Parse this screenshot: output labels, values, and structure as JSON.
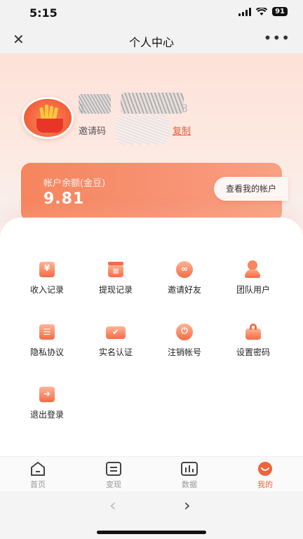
{
  "status_bar": {
    "time": "5:15",
    "battery": "91"
  },
  "nav": {
    "close_icon": "close-icon",
    "title": "个人中心",
    "more_icon": "more-icon"
  },
  "profile": {
    "user_id_prefix": "1",
    "user_id_suffix": "3",
    "invite_label": "邀请码",
    "copy_label": "复制"
  },
  "balance": {
    "label": "帐户余额(金豆)",
    "value": "9.81",
    "account_button": "查看我的帐户"
  },
  "menu": [
    {
      "label": "收入记录",
      "icon": "income-record-icon"
    },
    {
      "label": "提现记录",
      "icon": "withdraw-record-icon"
    },
    {
      "label": "邀请好友",
      "icon": "invite-friends-icon"
    },
    {
      "label": "团队用户",
      "icon": "team-users-icon"
    },
    {
      "label": "隐私协议",
      "icon": "privacy-icon"
    },
    {
      "label": "实名认证",
      "icon": "id-verify-icon"
    },
    {
      "label": "注销帐号",
      "icon": "power-icon"
    },
    {
      "label": "设置密码",
      "icon": "lock-icon"
    },
    {
      "label": "退出登录",
      "icon": "logout-icon"
    }
  ],
  "tabs": [
    {
      "label": "首页",
      "icon": "home-icon",
      "active": false
    },
    {
      "label": "变现",
      "icon": "cash-icon",
      "active": false
    },
    {
      "label": "数据",
      "icon": "chart-icon",
      "active": false
    },
    {
      "label": "我的",
      "icon": "profile-icon",
      "active": true
    }
  ],
  "colors": {
    "accent": "#f0643c",
    "card": "#f6855e"
  }
}
